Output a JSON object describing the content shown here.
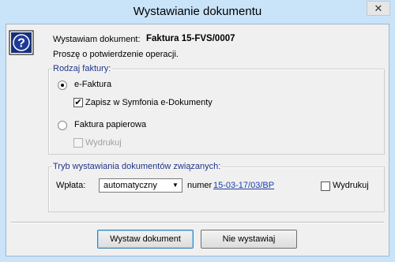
{
  "window": {
    "title": "Wystawianie dokumentu",
    "close_glyph": "✕"
  },
  "header": {
    "doc_label": "Wystawiam dokument:",
    "doc_number": "Faktura 15-FVS/0007",
    "confirm_text": "Proszę o potwierdzenie operacji.",
    "icon": "question-icon"
  },
  "invoice_type": {
    "legend": "Rodzaj faktury:",
    "efaktura_label": "e-Faktura",
    "efaktura_selected": true,
    "save_symfonia_label": "Zapisz w Symfonia e-Dokumenty",
    "save_symfonia_checked": true,
    "paper_label": "Faktura papierowa",
    "paper_selected": false,
    "print_label": "Wydrukuj",
    "print_checked": false,
    "print_enabled": false
  },
  "related": {
    "legend": "Tryb wystawiania dokumentów związanych:",
    "payment_label": "Wpłata:",
    "payment_value": "automatyczny",
    "number_label": "numer",
    "number_value": "15-03-17/03/BP",
    "print_label": "Wydrukuj",
    "print_checked": false
  },
  "buttons": {
    "issue_label": "Wystaw dokument",
    "cancel_label": "Nie wystawiaj"
  },
  "colors": {
    "title_bg": "#c9e3f9",
    "dialog_bg": "#f0f0f0",
    "legend_text": "#1e3287",
    "link": "#1a3fb0"
  }
}
